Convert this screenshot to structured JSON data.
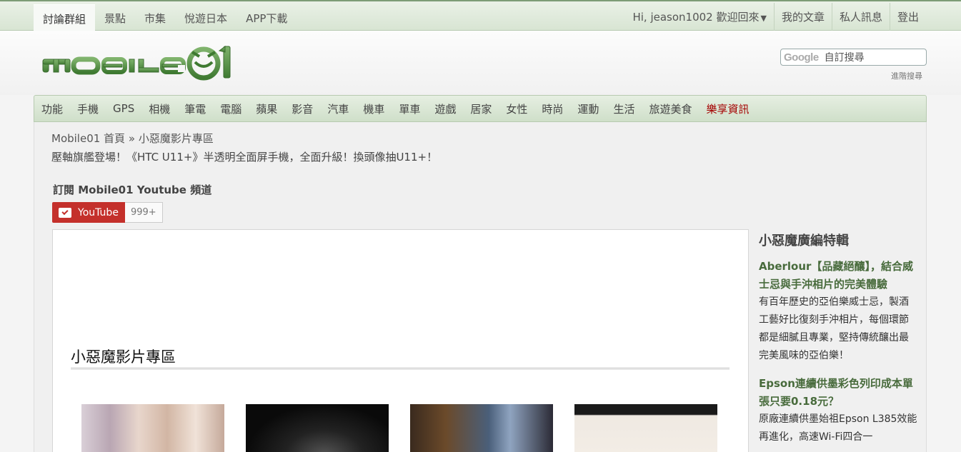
{
  "top_nav": {
    "tabs": [
      {
        "label": "討論群組",
        "active": true
      },
      {
        "label": "景點",
        "active": false
      },
      {
        "label": "市集",
        "active": false
      },
      {
        "label": "悅遊日本",
        "active": false
      },
      {
        "label": "APP下載",
        "active": false
      }
    ],
    "user_greeting": "Hi, jeason1002 歡迎回來",
    "my_articles": "我的文章",
    "private_messages": "私人訊息",
    "logout": "登出"
  },
  "header": {
    "logo_text": "MOBILE01",
    "search_brand": "Google",
    "search_placeholder": "自訂搜尋",
    "advanced_search": "進階搜尋"
  },
  "category_nav": {
    "items": [
      "功能",
      "手機",
      "GPS",
      "相機",
      "筆電",
      "電腦",
      "蘋果",
      "影音",
      "汽車",
      "機車",
      "單車",
      "遊戲",
      "居家",
      "女性",
      "時尚",
      "運動",
      "生活",
      "旅遊美食"
    ],
    "special_item": "樂享資訊",
    "special_color": "#a40000"
  },
  "main": {
    "breadcrumb_home": "Mobile01 首頁",
    "breadcrumb_sep": "»",
    "breadcrumb_current": "小惡魔影片專區",
    "headline": "壓軸旗艦登場！《HTC U11+》半透明全面屏手機，全面升級！換頭像抽U11+！",
    "subscribe_title": "訂閱 Mobile01 Youtube 頻道",
    "youtube_label": "YouTube",
    "youtube_count": "999+",
    "youtube_color": "#c4302b",
    "panel_title": "小惡魔影片專區",
    "thumbnails": [
      {
        "name": "thumb-girls"
      },
      {
        "name": "thumb-camera"
      },
      {
        "name": "thumb-event"
      },
      {
        "name": "thumb-models"
      }
    ]
  },
  "sidebar": {
    "title": "小惡魔廣編特輯",
    "articles": [
      {
        "title": "Aberlour【品藏絕釀】，結合威士忌與手沖相片的完美體驗",
        "desc": "有百年歷史的亞伯樂威士忌，製酒工藝好比復刻手沖相片，每個環節都是細膩且專業，堅持傳統釀出最完美風味的亞伯樂！"
      },
      {
        "title": "Epson連續供墨彩色列印成本單張只要0.18元？",
        "desc": "原廠連續供墨始祖Epson L385效能再進化，高速Wi-Fi四合一"
      }
    ],
    "title_color": "#486b3c"
  }
}
